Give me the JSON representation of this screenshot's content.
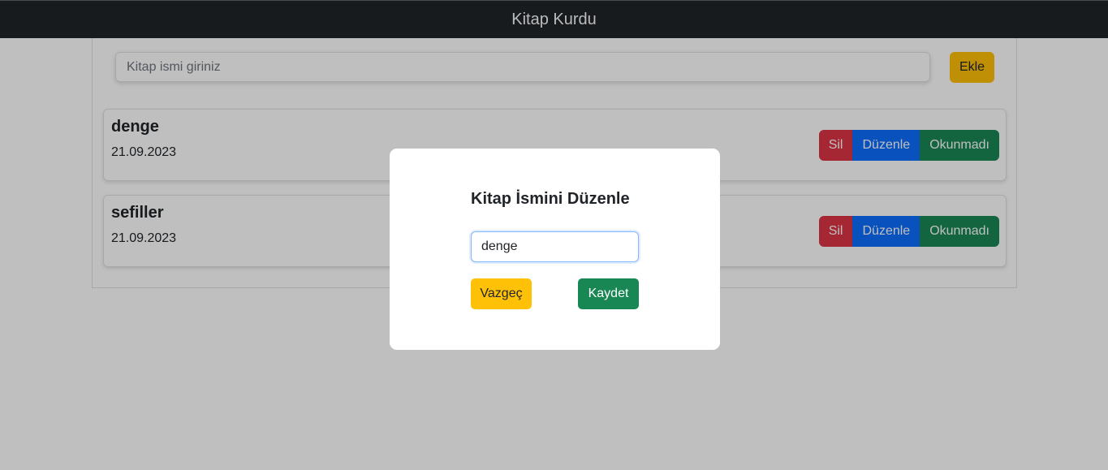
{
  "navbar": {
    "title": "Kitap Kurdu"
  },
  "search": {
    "placeholder": "Kitap ismi giriniz",
    "value": ""
  },
  "add_button_label": "Ekle",
  "books": [
    {
      "title": "denge",
      "date": "21.09.2023",
      "delete_label": "Sil",
      "edit_label": "Düzenle",
      "status_label": "Okunmadı"
    },
    {
      "title": "sefiller",
      "date": "21.09.2023",
      "delete_label": "Sil",
      "edit_label": "Düzenle",
      "status_label": "Okunmadı"
    }
  ],
  "modal": {
    "title": "Kitap İsmini Düzenle",
    "input_value": "denge",
    "cancel_label": "Vazgeç",
    "save_label": "Kaydet"
  },
  "colors": {
    "navbar": "#212529",
    "warning": "#ffc107",
    "danger": "#dc3545",
    "primary": "#0d6efd",
    "success": "#198754"
  }
}
